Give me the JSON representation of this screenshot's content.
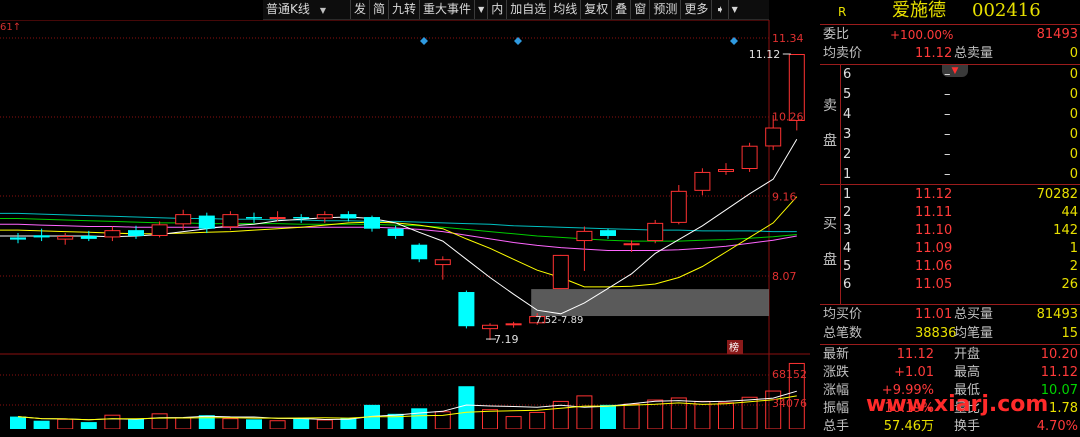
{
  "toolbar": {
    "kline_type": "普通K线",
    "buttons": [
      "发",
      "简",
      "九转",
      "重大事件",
      "内",
      "加自选",
      "均线",
      "复权",
      "叠",
      "窗",
      "预测",
      "更多"
    ]
  },
  "corner_label": "61↑",
  "stock": {
    "flag": "R",
    "name": "爱施德",
    "code": "002416"
  },
  "header": {
    "weibi_label": "委比",
    "weibi_value": "+100.00%",
    "weicha_value": "81493",
    "avg_sell_label": "均卖价",
    "avg_sell_value": "11.12",
    "total_sell_label": "总卖量",
    "total_sell_value": "0"
  },
  "sell_side_label": [
    "卖",
    "盘"
  ],
  "buy_side_label": [
    "买",
    "盘"
  ],
  "sell_orders": [
    {
      "level": "6",
      "price": "–",
      "volume": "0"
    },
    {
      "level": "5",
      "price": "–",
      "volume": "0"
    },
    {
      "level": "4",
      "price": "–",
      "volume": "0"
    },
    {
      "level": "3",
      "price": "–",
      "volume": "0"
    },
    {
      "level": "2",
      "price": "–",
      "volume": "0"
    },
    {
      "level": "1",
      "price": "–",
      "volume": "0"
    }
  ],
  "buy_orders": [
    {
      "level": "1",
      "price": "11.12",
      "volume": "70282"
    },
    {
      "level": "2",
      "price": "11.11",
      "volume": "44"
    },
    {
      "level": "3",
      "price": "11.10",
      "volume": "142"
    },
    {
      "level": "4",
      "price": "11.09",
      "volume": "1"
    },
    {
      "level": "5",
      "price": "11.06",
      "volume": "2"
    },
    {
      "level": "6",
      "price": "11.05",
      "volume": "26"
    }
  ],
  "summary": {
    "avg_buy_label": "均买价",
    "avg_buy_value": "11.01",
    "total_buy_label": "总买量",
    "total_buy_value": "81493",
    "total_trades_label": "总笔数",
    "total_trades_value": "38836",
    "avg_trade_label": "均笔量",
    "avg_trade_value": "15"
  },
  "quote": [
    {
      "label": "最新",
      "value": "11.12",
      "label2": "开盘",
      "value2": "10.20"
    },
    {
      "label": "涨跌",
      "value": "+1.01",
      "label2": "最高",
      "value2": "11.12"
    },
    {
      "label": "涨幅",
      "value": "+9.99%",
      "label2": "最低",
      "value2": "10.07"
    },
    {
      "label": "振幅",
      "value": "10.19%",
      "label2": "量比",
      "value2": "1.78"
    },
    {
      "label": "总手",
      "value": "57.46万",
      "label2": "换手",
      "value2": "4.70%"
    }
  ],
  "watermark": "www.xiarj.com",
  "colors": {
    "up": "#ff3232",
    "down": "#00ffff",
    "ma5": "#ffffff",
    "ma10": "#ffff00",
    "ma20": "#ff66ff",
    "ma30": "#00cc00",
    "ma60": "#00bfbf",
    "grid": "#8a1010"
  },
  "chart_data": {
    "type": "candlestick",
    "price_axis": [
      11.34,
      10.26,
      9.16,
      8.07
    ],
    "volume_axis": [
      68152,
      34076
    ],
    "price_range": [
      6.8,
      11.5
    ],
    "annotations": {
      "high_label": "11.12",
      "low_label": "7.19",
      "zone_label": "7.52-7.89",
      "zone": [
        7.52,
        7.89
      ],
      "badge": "榜"
    },
    "candles": [
      {
        "o": 8.6,
        "h": 8.66,
        "l": 8.52,
        "c": 8.57
      },
      {
        "o": 8.63,
        "h": 8.72,
        "l": 8.55,
        "c": 8.6
      },
      {
        "o": 8.57,
        "h": 8.66,
        "l": 8.5,
        "c": 8.62
      },
      {
        "o": 8.62,
        "h": 8.69,
        "l": 8.55,
        "c": 8.58
      },
      {
        "o": 8.6,
        "h": 8.75,
        "l": 8.55,
        "c": 8.7
      },
      {
        "o": 8.7,
        "h": 8.76,
        "l": 8.58,
        "c": 8.62
      },
      {
        "o": 8.62,
        "h": 8.82,
        "l": 8.6,
        "c": 8.78
      },
      {
        "o": 8.78,
        "h": 8.98,
        "l": 8.7,
        "c": 8.92
      },
      {
        "o": 8.9,
        "h": 8.94,
        "l": 8.66,
        "c": 8.72
      },
      {
        "o": 8.74,
        "h": 8.96,
        "l": 8.7,
        "c": 8.92
      },
      {
        "o": 8.88,
        "h": 8.94,
        "l": 8.8,
        "c": 8.86
      },
      {
        "o": 8.86,
        "h": 8.96,
        "l": 8.82,
        "c": 8.88
      },
      {
        "o": 8.88,
        "h": 8.92,
        "l": 8.8,
        "c": 8.86
      },
      {
        "o": 8.86,
        "h": 8.96,
        "l": 8.8,
        "c": 8.92
      },
      {
        "o": 8.92,
        "h": 8.96,
        "l": 8.82,
        "c": 8.86
      },
      {
        "o": 8.88,
        "h": 8.9,
        "l": 8.68,
        "c": 8.72
      },
      {
        "o": 8.72,
        "h": 8.76,
        "l": 8.58,
        "c": 8.62
      },
      {
        "o": 8.5,
        "h": 8.52,
        "l": 8.26,
        "c": 8.3
      },
      {
        "o": 8.22,
        "h": 8.34,
        "l": 8.02,
        "c": 8.3
      },
      {
        "o": 7.85,
        "h": 7.87,
        "l": 7.35,
        "c": 7.38
      },
      {
        "o": 7.34,
        "h": 7.42,
        "l": 7.19,
        "c": 7.4
      },
      {
        "o": 7.4,
        "h": 7.44,
        "l": 7.36,
        "c": 7.42
      },
      {
        "o": 7.42,
        "h": 7.56,
        "l": 7.4,
        "c": 7.52
      },
      {
        "o": 7.89,
        "h": 8.36,
        "l": 7.89,
        "c": 8.36
      },
      {
        "o": 8.55,
        "h": 8.75,
        "l": 8.14,
        "c": 8.69
      },
      {
        "o": 8.7,
        "h": 8.72,
        "l": 8.58,
        "c": 8.62
      },
      {
        "o": 8.5,
        "h": 8.56,
        "l": 8.4,
        "c": 8.52
      },
      {
        "o": 8.55,
        "h": 8.84,
        "l": 8.52,
        "c": 8.8
      },
      {
        "o": 8.8,
        "h": 9.32,
        "l": 8.78,
        "c": 9.24
      },
      {
        "o": 9.24,
        "h": 9.55,
        "l": 9.18,
        "c": 9.5
      },
      {
        "o": 9.5,
        "h": 9.62,
        "l": 9.46,
        "c": 9.54
      },
      {
        "o": 9.54,
        "h": 9.9,
        "l": 9.5,
        "c": 9.86
      },
      {
        "o": 9.85,
        "h": 10.28,
        "l": 9.8,
        "c": 10.11
      },
      {
        "o": 10.2,
        "h": 11.12,
        "l": 10.07,
        "c": 11.12
      }
    ],
    "volumes": [
      0.18,
      0.12,
      0.14,
      0.1,
      0.2,
      0.15,
      0.22,
      0.16,
      0.2,
      0.15,
      0.14,
      0.12,
      0.15,
      0.13,
      0.16,
      0.35,
      0.22,
      0.3,
      0.25,
      0.62,
      0.28,
      0.18,
      0.24,
      0.4,
      0.48,
      0.35,
      0.36,
      0.42,
      0.45,
      0.4,
      0.38,
      0.46,
      0.55,
      0.95
    ],
    "ma5": [
      8.62,
      8.62,
      8.62,
      8.62,
      8.61,
      8.62,
      8.64,
      8.68,
      8.72,
      8.76,
      8.78,
      8.83,
      8.85,
      8.87,
      8.88,
      8.86,
      8.8,
      8.67,
      8.55,
      8.3,
      8.05,
      7.82,
      7.6,
      7.55,
      7.7,
      7.9,
      8.1,
      8.38,
      8.57,
      8.76,
      8.98,
      9.2,
      9.4,
      9.95
    ],
    "ma10": [
      8.7,
      8.69,
      8.68,
      8.67,
      8.66,
      8.65,
      8.65,
      8.66,
      8.67,
      8.68,
      8.7,
      8.72,
      8.74,
      8.77,
      8.8,
      8.81,
      8.8,
      8.77,
      8.72,
      8.58,
      8.45,
      8.3,
      8.15,
      8.05,
      7.92,
      7.92,
      7.93,
      7.96,
      8.05,
      8.2,
      8.4,
      8.6,
      8.8,
      9.16
    ],
    "ma20": [
      8.78,
      8.77,
      8.76,
      8.75,
      8.75,
      8.74,
      8.74,
      8.74,
      8.74,
      8.74,
      8.74,
      8.74,
      8.74,
      8.74,
      8.74,
      8.74,
      8.73,
      8.71,
      8.68,
      8.63,
      8.58,
      8.53,
      8.49,
      8.46,
      8.44,
      8.42,
      8.42,
      8.42,
      8.43,
      8.45,
      8.48,
      8.52,
      8.56,
      8.62
    ],
    "ma30": [
      8.86,
      8.85,
      8.84,
      8.83,
      8.82,
      8.81,
      8.8,
      8.8,
      8.79,
      8.79,
      8.79,
      8.79,
      8.78,
      8.78,
      8.78,
      8.78,
      8.77,
      8.76,
      8.74,
      8.71,
      8.68,
      8.65,
      8.62,
      8.6,
      8.58,
      8.56,
      8.55,
      8.55,
      8.55,
      8.56,
      8.57,
      8.59,
      8.61,
      8.64
    ],
    "ma60": [
      8.93,
      8.92,
      8.91,
      8.9,
      8.89,
      8.88,
      8.87,
      8.86,
      8.86,
      8.85,
      8.85,
      8.84,
      8.84,
      8.83,
      8.83,
      8.82,
      8.82,
      8.81,
      8.8,
      8.79,
      8.78,
      8.76,
      8.75,
      8.74,
      8.73,
      8.72,
      8.71,
      8.7,
      8.7,
      8.69,
      8.69,
      8.69,
      8.68,
      8.68
    ]
  }
}
